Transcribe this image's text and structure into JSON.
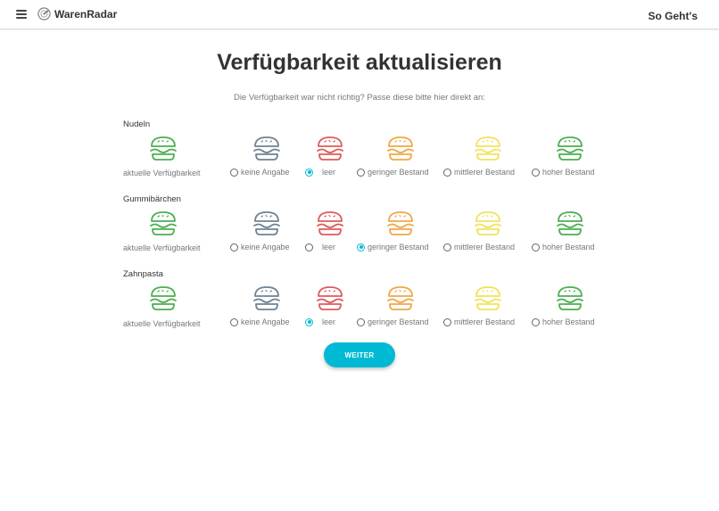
{
  "app": {
    "name": "WarenRadar",
    "menu_icon": "hamburger-menu-icon",
    "logo_icon": "warenradar-logo-icon",
    "howto_link": "So Geht's"
  },
  "page": {
    "title": "Verfügbarkeit aktualisieren",
    "subtitle": "Die Verfügbarkeit war nicht richtig? Passe diese bitte hier direkt an:"
  },
  "status_levels": [
    {
      "key": "keine",
      "label": "keine Angabe",
      "color": "#6f8393"
    },
    {
      "key": "leer",
      "label": "leer",
      "color": "#e05a5a"
    },
    {
      "key": "gering",
      "label": "geringer Bestand",
      "color": "#f0a848"
    },
    {
      "key": "mittel",
      "label": "mittlerer Bestand",
      "color": "#f2e25c"
    },
    {
      "key": "hoch",
      "label": "hoher Bestand",
      "color": "#4caf50"
    }
  ],
  "status_icon": "burger-icon",
  "current_label": "aktuelle Verfügbarkeit",
  "current_color": "#4caf50",
  "accent_color": "#00b9d4",
  "products": [
    {
      "name": "Nudeln",
      "selected": "leer"
    },
    {
      "name": "Gummibärchen",
      "selected": "gering"
    },
    {
      "name": "Zahnpasta",
      "selected": "leer"
    }
  ],
  "next_button": "WEITER"
}
